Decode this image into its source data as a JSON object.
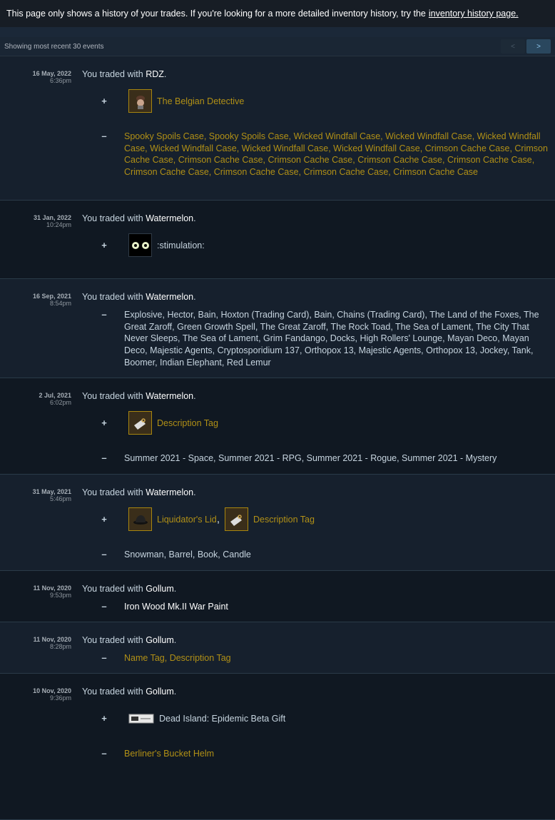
{
  "notice": {
    "text": "This page only shows a history of your trades. If you're looking for a more detailed inventory history, try the",
    "link": "inventory history page."
  },
  "status": {
    "text": "Showing most recent 30 events",
    "prev": "<",
    "next": ">"
  },
  "trade_prefix": "You traded with",
  "events": [
    {
      "date": "16 May, 2022",
      "time": "6:36pm",
      "partner": "RDZ",
      "received": [
        {
          "name": "The Belgian Detective",
          "icon": "detective-hat-icon"
        }
      ],
      "given_text": "Spooky Spoils Case, Spooky Spoils Case, Wicked Windfall Case, Wicked Windfall Case, Wicked Windfall Case, Wicked Windfall Case, Wicked Windfall Case, Wicked Windfall Case, Crimson Cache Case, Crimson Cache Case, Crimson Cache Case, Crimson Cache Case, Crimson Cache Case, Crimson Cache Case, Crimson Cache Case, Crimson Cache Case, Crimson Cache Case, Crimson Cache Case"
    },
    {
      "date": "31 Jan, 2022",
      "time": "10:24pm",
      "partner": "Watermelon",
      "received": [
        {
          "name": ":stimulation:",
          "icon": "stimulation-emoticon-icon"
        }
      ]
    },
    {
      "date": "16 Sep, 2021",
      "time": "8:54pm",
      "partner": "Watermelon",
      "given_text": "Explosive, Hector, Bain, Hoxton (Trading Card), Bain, Chains (Trading Card), The Land of the Foxes, The Great Zaroff, Green Growth Spell, The Great Zaroff, The Rock Toad, The Sea of Lament, The City That Never Sleeps, The Sea of Lament, Grim Fandango, Docks, High Rollers' Lounge, Mayan Deco, Mayan Deco, Majestic Agents, Cryptosporidium 137, Orthopox 13, Majestic Agents, Orthopox 13, Jockey, Tank, Boomer, Indian Elephant, Red Lemur"
    },
    {
      "date": "2 Jul, 2021",
      "time": "6:02pm",
      "partner": "Watermelon",
      "received": [
        {
          "name": "Description Tag",
          "icon": "description-tag-icon"
        }
      ],
      "given_text": "Summer 2021 - Space, Summer 2021 - RPG, Summer 2021 - Rogue, Summer 2021 - Mystery"
    },
    {
      "date": "31 May, 2021",
      "time": "5:46pm",
      "partner": "Watermelon",
      "received": [
        {
          "name": "Liquidator's Lid",
          "icon": "liquidator-lid-icon"
        },
        {
          "name": "Description Tag",
          "icon": "description-tag-icon"
        }
      ],
      "given_text": "Snowman, Barrel, Book, Candle"
    },
    {
      "date": "11 Nov, 2020",
      "time": "9:53pm",
      "partner": "Gollum",
      "given_text": "Iron Wood Mk.II War Paint"
    },
    {
      "date": "11 Nov, 2020",
      "time": "8:28pm",
      "partner": "Gollum",
      "given_text": "Name Tag, Description Tag"
    },
    {
      "date": "10 Nov, 2020",
      "time": "9:36pm",
      "partner": "Gollum",
      "received": [
        {
          "name": "Dead Island: Epidemic Beta Gift",
          "icon": "gift-ticket-icon"
        }
      ],
      "given_text": "Berliner's Bucket Helm"
    }
  ],
  "colors": {
    "item_quality": "#b19016",
    "normal_text": "#c6d4df",
    "partner": "#ffffff"
  }
}
